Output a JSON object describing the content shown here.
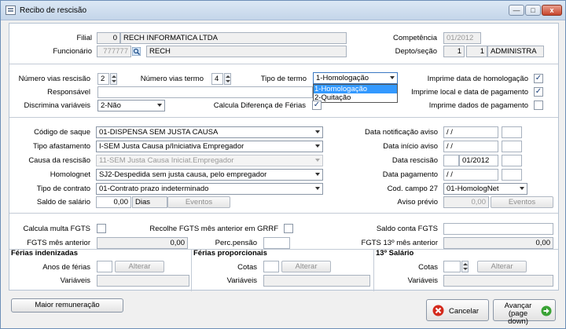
{
  "window": {
    "title": "Recibo de rescisão",
    "min_label": "—",
    "max_label": "□",
    "close_label": "x"
  },
  "filial": {
    "label": "Filial",
    "code": "0",
    "name": "RECH INFORMATICA LTDA"
  },
  "funcionario": {
    "label": "Funcionário",
    "code": "777777",
    "name": "RECH"
  },
  "competencia": {
    "label": "Competência",
    "value": "01/2012"
  },
  "depto": {
    "label": "Depto/seção",
    "depto": "1",
    "secao": "1",
    "name": "ADMINISTRA"
  },
  "vias_rescisao": {
    "label": "Número vias rescisão",
    "value": "2"
  },
  "vias_termo": {
    "label": "Número vias termo",
    "value": "4"
  },
  "tipo_termo": {
    "label": "Tipo de termo",
    "value": "1-Homologação",
    "options": [
      "1-Homologação",
      "2-Quitação"
    ]
  },
  "responsavel": {
    "label": "Responsável",
    "value": ""
  },
  "discrimina": {
    "label": "Discrimina variáveis",
    "value": "2-Não"
  },
  "calcula_ferias": {
    "label": "Calcula Diferença de Férias",
    "checked": "✓"
  },
  "imprime_homologacao": {
    "label": "Imprime data de homologação",
    "checked": "✓"
  },
  "imprime_local": {
    "label": "Imprime local e data de pagamento",
    "checked": "✓"
  },
  "imprime_dados": {
    "label": "Imprime dados de pagamento",
    "checked": ""
  },
  "codigo_saque": {
    "label": "Código de saque",
    "value": "01-DISPENSA SEM JUSTA CAUSA"
  },
  "tipo_afastamento": {
    "label": "Tipo afastamento",
    "value": "I-SEM Justa Causa p/Iniciativa Empregador"
  },
  "causa_rescisao": {
    "label": "Causa da rescisão",
    "value": "11-SEM Justa Causa Iniciat.Empregador"
  },
  "homolognet": {
    "label": "Homolognet",
    "value": "SJ2-Despedida sem justa causa, pelo empregador"
  },
  "tipo_contrato": {
    "label": "Tipo de contrato",
    "value": "01-Contrato prazo indeterminado"
  },
  "saldo_salario": {
    "label": "Saldo de salário",
    "value": "0,00",
    "unit": "Dias",
    "events_label": "Eventos"
  },
  "data_notificacao": {
    "label": "Data notificação aviso",
    "value": " / /"
  },
  "data_inicio": {
    "label": "Data início aviso",
    "value": " / /"
  },
  "data_rescisao": {
    "label": "Data rescisão",
    "value": "01/2012"
  },
  "data_pagamento": {
    "label": "Data pagamento",
    "value": " / /"
  },
  "cod_campo27": {
    "label": "Cod. campo 27",
    "value": "01-HomologNet"
  },
  "aviso_previo": {
    "label": "Aviso prévio",
    "value": "0,00",
    "events_label": "Eventos"
  },
  "calcula_multa": {
    "label": "Calcula multa FGTS",
    "checked": ""
  },
  "recolhe_fgts": {
    "label": "Recolhe FGTS mês anterior em GRRF",
    "checked": ""
  },
  "saldo_fgts": {
    "label": "Saldo conta FGTS",
    "value": ""
  },
  "fgts_mes_anterior": {
    "label": "FGTS mês anterior",
    "value": "0,00"
  },
  "perc_pensao": {
    "label": "Perc.pensão",
    "value": ""
  },
  "fgts_13": {
    "label": "FGTS 13º mês anterior",
    "value": "0,00"
  },
  "ferias_indenizadas": {
    "title": "Férias indenizadas",
    "anos_label": "Anos de férias",
    "alterar_label": "Alterar",
    "variaveis_label": "Variáveis"
  },
  "ferias_proporcionais": {
    "title": "Férias proporcionais",
    "cotas_label": "Cotas",
    "alterar_label": "Alterar",
    "variaveis_label": "Variáveis"
  },
  "decimo_terceiro": {
    "title": "13º Salário",
    "cotas_label": "Cotas",
    "alterar_label": "Alterar",
    "variaveis_label": "Variáveis"
  },
  "footer": {
    "maior_remuneracao": "Maior remuneração",
    "cancelar": "Cancelar",
    "avancar_line1": "Avançar",
    "avancar_line2": "(page down)"
  },
  "colors": {
    "accent_select": "#3399ff",
    "cancel_icon": "#d42a1c",
    "advance_icon": "#3aa335"
  }
}
